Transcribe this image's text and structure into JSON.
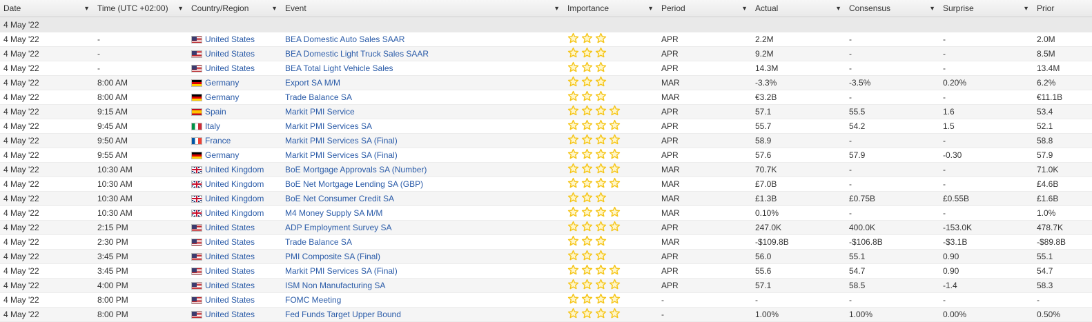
{
  "columns": [
    "Date",
    "Time (UTC +02:00)",
    "Country/Region",
    "Event",
    "Importance",
    "Period",
    "Actual",
    "Consensus",
    "Surprise",
    "Prior"
  ],
  "group_label": "4 May '22",
  "star_color": "#f5c518",
  "rows": [
    {
      "date": "4 May '22",
      "time": "-",
      "country": "United States",
      "flag": "us",
      "event": "BEA Domestic Auto Sales SAAR",
      "stars": 3,
      "period": "APR",
      "actual": "2.2M",
      "consensus": "-",
      "surprise": "-",
      "prior": "2.0M"
    },
    {
      "date": "4 May '22",
      "time": "-",
      "country": "United States",
      "flag": "us",
      "event": "BEA Domestic Light Truck Sales SAAR",
      "stars": 3,
      "period": "APR",
      "actual": "9.2M",
      "consensus": "-",
      "surprise": "-",
      "prior": "8.5M"
    },
    {
      "date": "4 May '22",
      "time": "-",
      "country": "United States",
      "flag": "us",
      "event": "BEA Total Light Vehicle Sales",
      "stars": 3,
      "period": "APR",
      "actual": "14.3M",
      "consensus": "-",
      "surprise": "-",
      "prior": "13.4M"
    },
    {
      "date": "4 May '22",
      "time": "8:00 AM",
      "country": "Germany",
      "flag": "de",
      "event": "Export SA M/M",
      "stars": 3,
      "period": "MAR",
      "actual": "-3.3%",
      "consensus": "-3.5%",
      "surprise": "0.20%",
      "prior": "6.2%"
    },
    {
      "date": "4 May '22",
      "time": "8:00 AM",
      "country": "Germany",
      "flag": "de",
      "event": "Trade Balance SA",
      "stars": 3,
      "period": "MAR",
      "actual": "€3.2B",
      "consensus": "-",
      "surprise": "-",
      "prior": "€11.1B"
    },
    {
      "date": "4 May '22",
      "time": "9:15 AM",
      "country": "Spain",
      "flag": "es",
      "event": "Markit PMI Service",
      "stars": 4,
      "period": "APR",
      "actual": "57.1",
      "consensus": "55.5",
      "surprise": "1.6",
      "prior": "53.4"
    },
    {
      "date": "4 May '22",
      "time": "9:45 AM",
      "country": "Italy",
      "flag": "it",
      "event": "Markit PMI Services SA",
      "stars": 4,
      "period": "APR",
      "actual": "55.7",
      "consensus": "54.2",
      "surprise": "1.5",
      "prior": "52.1"
    },
    {
      "date": "4 May '22",
      "time": "9:50 AM",
      "country": "France",
      "flag": "fr",
      "event": "Markit PMI Services SA (Final)",
      "stars": 4,
      "period": "APR",
      "actual": "58.9",
      "consensus": "-",
      "surprise": "-",
      "prior": "58.8"
    },
    {
      "date": "4 May '22",
      "time": "9:55 AM",
      "country": "Germany",
      "flag": "de",
      "event": "Markit PMI Services SA (Final)",
      "stars": 4,
      "period": "APR",
      "actual": "57.6",
      "consensus": "57.9",
      "surprise": "-0.30",
      "prior": "57.9"
    },
    {
      "date": "4 May '22",
      "time": "10:30 AM",
      "country": "United Kingdom",
      "flag": "gb",
      "event": "BoE Mortgage Approvals SA (Number)",
      "stars": 4,
      "period": "MAR",
      "actual": "70.7K",
      "consensus": "-",
      "surprise": "-",
      "prior": "71.0K"
    },
    {
      "date": "4 May '22",
      "time": "10:30 AM",
      "country": "United Kingdom",
      "flag": "gb",
      "event": "BoE Net Mortgage Lending SA (GBP)",
      "stars": 4,
      "period": "MAR",
      "actual": "£7.0B",
      "consensus": "-",
      "surprise": "-",
      "prior": "£4.6B"
    },
    {
      "date": "4 May '22",
      "time": "10:30 AM",
      "country": "United Kingdom",
      "flag": "gb",
      "event": "BoE Net Consumer Credit SA",
      "stars": 3,
      "period": "MAR",
      "actual": "£1.3B",
      "consensus": "£0.75B",
      "surprise": "£0.55B",
      "prior": "£1.6B"
    },
    {
      "date": "4 May '22",
      "time": "10:30 AM",
      "country": "United Kingdom",
      "flag": "gb",
      "event": "M4 Money Supply SA M/M",
      "stars": 4,
      "period": "MAR",
      "actual": "0.10%",
      "consensus": "-",
      "surprise": "-",
      "prior": "1.0%"
    },
    {
      "date": "4 May '22",
      "time": "2:15 PM",
      "country": "United States",
      "flag": "us",
      "event": "ADP Employment Survey SA",
      "stars": 4,
      "period": "APR",
      "actual": "247.0K",
      "consensus": "400.0K",
      "surprise": "-153.0K",
      "prior": "478.7K"
    },
    {
      "date": "4 May '22",
      "time": "2:30 PM",
      "country": "United States",
      "flag": "us",
      "event": "Trade Balance SA",
      "stars": 3,
      "period": "MAR",
      "actual": "-$109.8B",
      "consensus": "-$106.8B",
      "surprise": "-$3.1B",
      "prior": "-$89.8B"
    },
    {
      "date": "4 May '22",
      "time": "3:45 PM",
      "country": "United States",
      "flag": "us",
      "event": "PMI Composite SA (Final)",
      "stars": 3,
      "period": "APR",
      "actual": "56.0",
      "consensus": "55.1",
      "surprise": "0.90",
      "prior": "55.1"
    },
    {
      "date": "4 May '22",
      "time": "3:45 PM",
      "country": "United States",
      "flag": "us",
      "event": "Markit PMI Services SA (Final)",
      "stars": 4,
      "period": "APR",
      "actual": "55.6",
      "consensus": "54.7",
      "surprise": "0.90",
      "prior": "54.7"
    },
    {
      "date": "4 May '22",
      "time": "4:00 PM",
      "country": "United States",
      "flag": "us",
      "event": "ISM Non Manufacturing SA",
      "stars": 4,
      "period": "APR",
      "actual": "57.1",
      "consensus": "58.5",
      "surprise": "-1.4",
      "prior": "58.3"
    },
    {
      "date": "4 May '22",
      "time": "8:00 PM",
      "country": "United States",
      "flag": "us",
      "event": "FOMC Meeting",
      "stars": 4,
      "period": "-",
      "actual": "-",
      "consensus": "-",
      "surprise": "-",
      "prior": "-"
    },
    {
      "date": "4 May '22",
      "time": "8:00 PM",
      "country": "United States",
      "flag": "us",
      "event": "Fed Funds Target Upper Bound",
      "stars": 4,
      "period": "-",
      "actual": "1.00%",
      "consensus": "1.00%",
      "surprise": "0.00%",
      "prior": "0.50%"
    }
  ]
}
